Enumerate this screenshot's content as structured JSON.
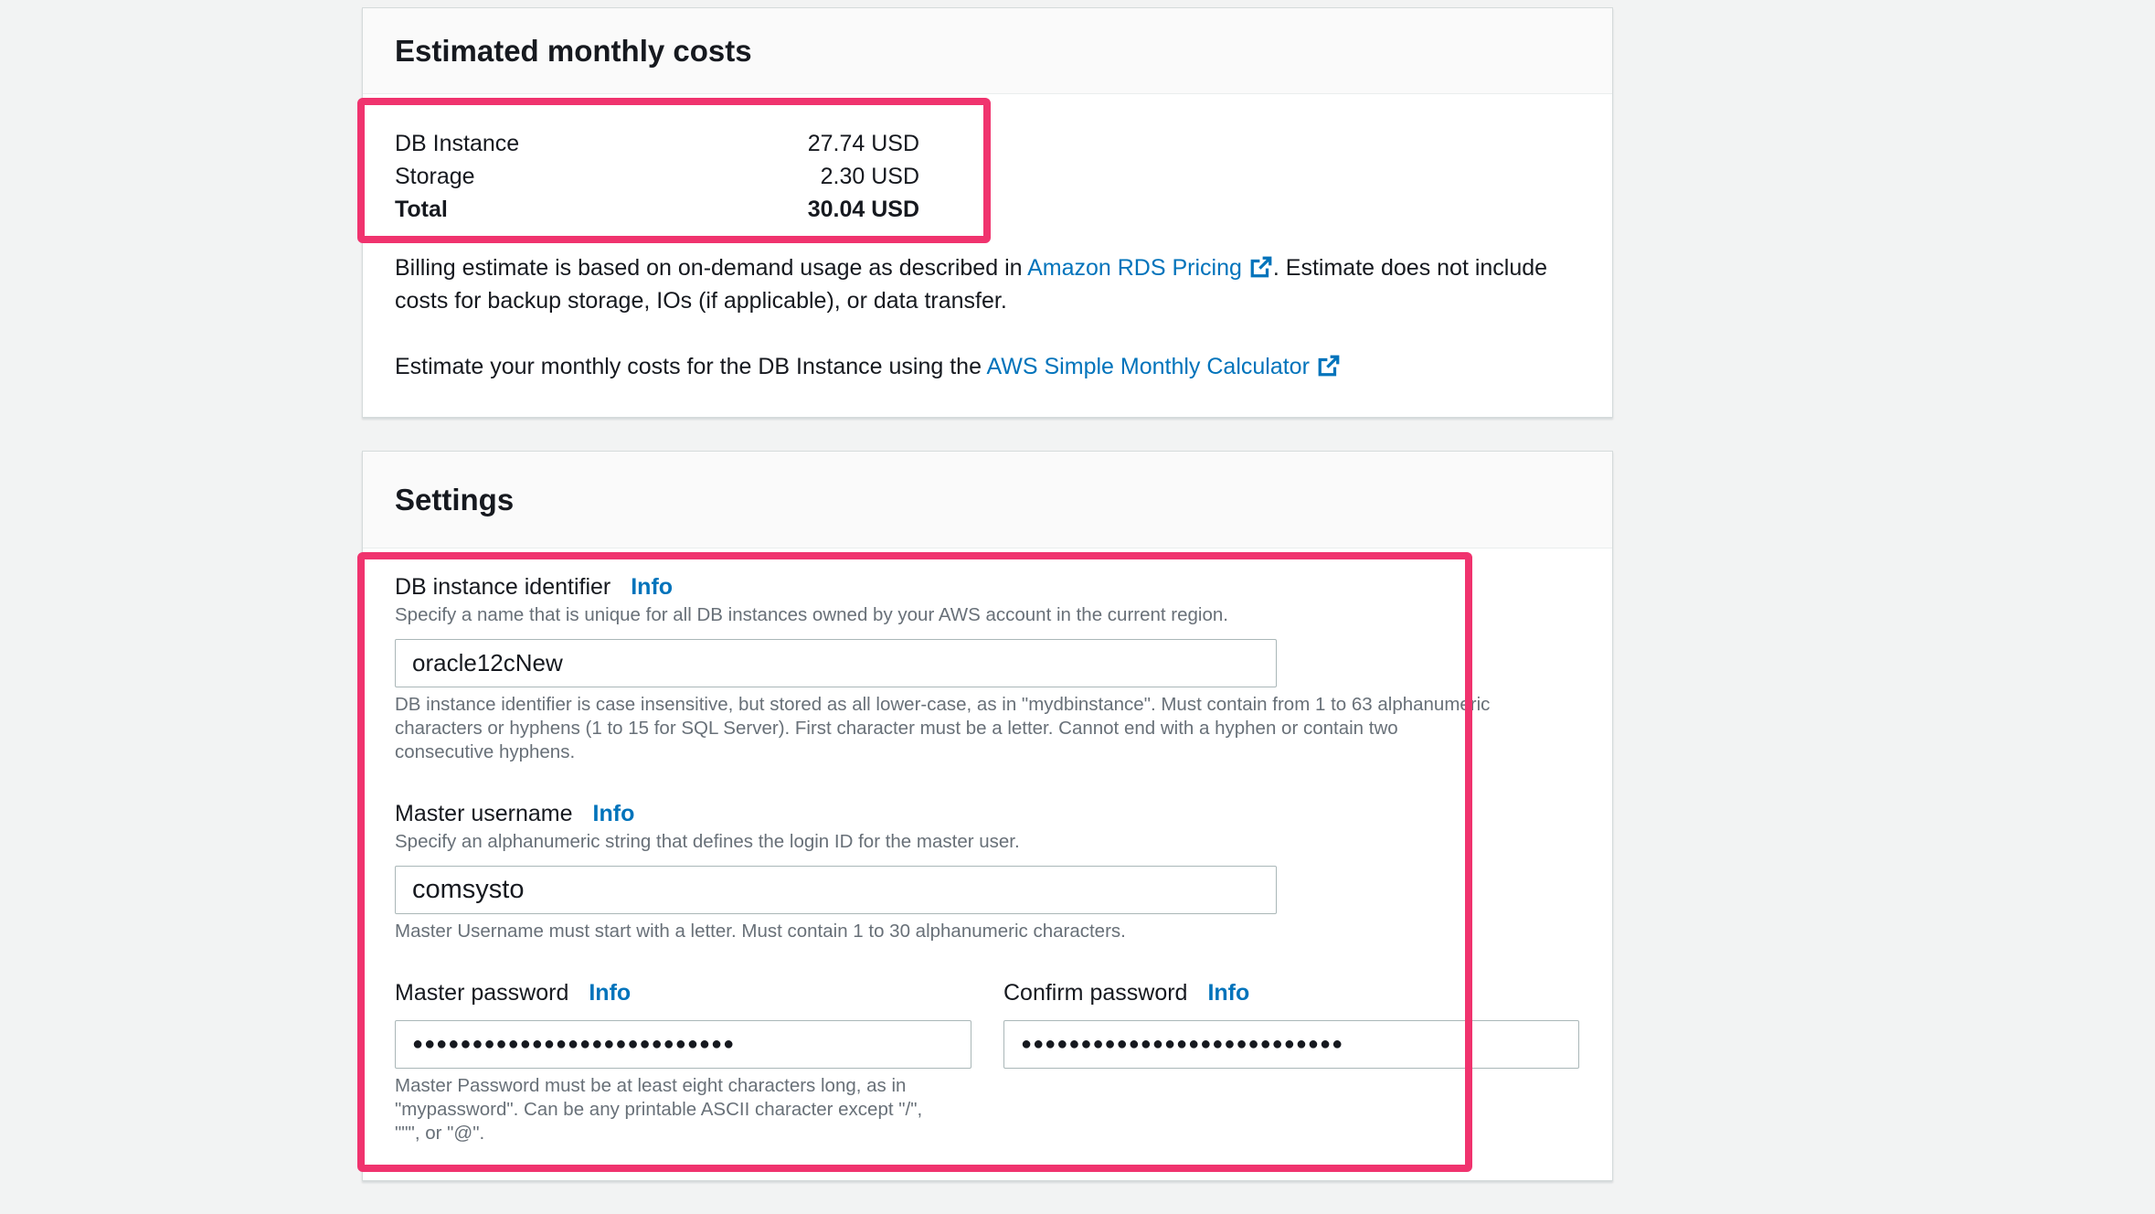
{
  "cost_panel": {
    "title": "Estimated monthly costs",
    "rows": [
      {
        "label": "DB Instance",
        "value": "27.74 USD"
      },
      {
        "label": "Storage",
        "value": "2.30 USD"
      },
      {
        "label": "Total",
        "value": "30.04 USD"
      }
    ],
    "billing_text_1": "Billing estimate is based on on-demand usage as described in ",
    "billing_link": "Amazon RDS Pricing",
    "billing_text_2": ". Estimate does not include",
    "billing_text_3": "costs for backup storage, IOs (if applicable), or data transfer.",
    "calc_text": "Estimate your monthly costs for the DB Instance using the ",
    "calc_link": "AWS Simple Monthly Calculator"
  },
  "settings": {
    "title": "Settings",
    "info_label": "Info",
    "db_identifier": {
      "label": "DB instance identifier",
      "description": "Specify a name that is unique for all DB instances owned by your AWS account in the current region.",
      "value": "oracle12cNew",
      "constraint_1": "DB instance identifier is case insensitive, but stored as all lower-case, as in \"mydbinstance\". Must contain from 1 to 63 alphanumeric",
      "constraint_2": "characters or hyphens (1 to 15 for SQL Server). First character must be a letter. Cannot end with a hyphen or contain two",
      "constraint_3": "consecutive hyphens."
    },
    "master_username": {
      "label": "Master username",
      "description": "Specify an alphanumeric string that defines the login ID for the master user.",
      "value": "comsysto",
      "constraint": "Master Username must start with a letter. Must contain 1 to 30 alphanumeric characters."
    },
    "master_password": {
      "label": "Master password",
      "value": "●●●●●●●●●●●●●●●●●●●●●●●●●●●",
      "constraint_1": "Master Password must be at least eight characters long, as in",
      "constraint_2": "\"mypassword\". Can be any printable ASCII character except \"/\",",
      "constraint_3": "\"\"\", or \"@\"."
    },
    "confirm_password": {
      "label": "Confirm password",
      "value": "●●●●●●●●●●●●●●●●●●●●●●●●●●●"
    }
  },
  "colors": {
    "accent_link": "#0073bb",
    "highlight": "#f0336e",
    "muted_text": "#687078"
  }
}
